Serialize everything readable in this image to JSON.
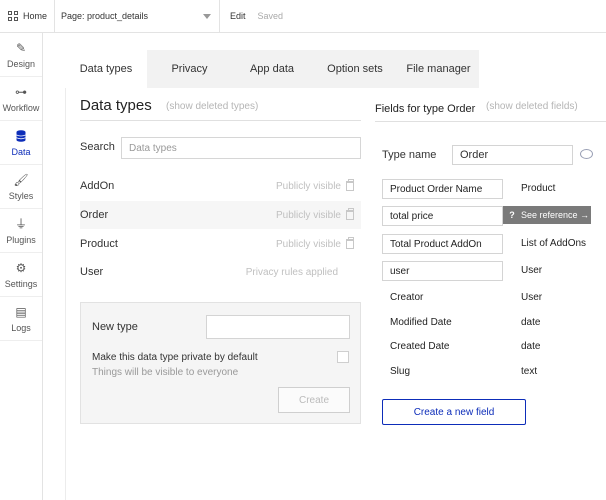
{
  "topbar": {
    "home_label": "Home",
    "page_label": "Page: product_details",
    "edit_label": "Edit",
    "status_label": "Saved"
  },
  "sidebar": {
    "items": [
      {
        "label": "Design",
        "icon": "design-icon"
      },
      {
        "label": "Workflow",
        "icon": "workflow-icon"
      },
      {
        "label": "Data",
        "icon": "database-icon"
      },
      {
        "label": "Styles",
        "icon": "brush-icon"
      },
      {
        "label": "Plugins",
        "icon": "plug-icon"
      },
      {
        "label": "Settings",
        "icon": "gear-icon"
      },
      {
        "label": "Logs",
        "icon": "document-icon"
      }
    ],
    "active": "Data"
  },
  "tabs": [
    "Data types",
    "Privacy",
    "App data",
    "Option sets",
    "File manager"
  ],
  "data_types": {
    "title": "Data types",
    "show_deleted": "(show deleted types)",
    "search_label": "Search",
    "search_placeholder": "Data types",
    "rows": [
      {
        "name": "AddOn",
        "status": "Publicly visible",
        "trash": true
      },
      {
        "name": "Order",
        "status": "Publicly visible",
        "trash": true
      },
      {
        "name": "Product",
        "status": "Publicly visible",
        "trash": true
      },
      {
        "name": "User",
        "status": "Privacy rules applied",
        "trash": false
      }
    ]
  },
  "new_type": {
    "label": "New type",
    "private_label": "Make this data type private by default",
    "private_sub": "Things will be visible to everyone",
    "create_label": "Create"
  },
  "fields": {
    "title": "Fields for type Order",
    "show_deleted": "(show deleted fields)",
    "type_name_label": "Type name",
    "type_name_value": "Order",
    "see_reference": "See reference →",
    "create_button": "Create a new field",
    "rows": [
      {
        "name": "Product Order Name",
        "type": "Product"
      },
      {
        "name": "total price",
        "type": ""
      },
      {
        "name": "Total Product AddOn",
        "type": "List of AddOns"
      },
      {
        "name": "user",
        "type": "User"
      },
      {
        "name": "Creator",
        "type": "User"
      },
      {
        "name": "Modified Date",
        "type": "date"
      },
      {
        "name": "Created Date",
        "type": "date"
      },
      {
        "name": "Slug",
        "type": "text"
      }
    ]
  },
  "colors": {
    "accent": "#0d2db9",
    "active_sidebar": "#0d2db9",
    "tab_bar": "#f2f2f2"
  }
}
